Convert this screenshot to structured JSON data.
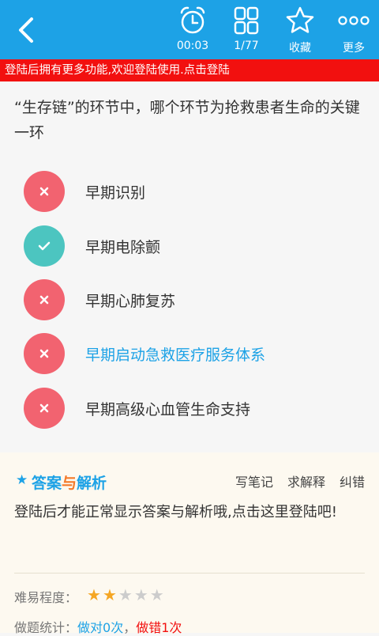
{
  "header": {
    "timer": "00:03",
    "progress": "1/77",
    "favorite_label": "收藏",
    "more_label": "更多"
  },
  "banner": {
    "text": "登陆后拥有更多功能,欢迎登陆使用.点击登陆"
  },
  "question": {
    "text": "“生存链”的环节中，哪个环节为抢救患者生命的关键一环"
  },
  "options": [
    {
      "label": "早期识别",
      "state": "wrong"
    },
    {
      "label": "早期电除颤",
      "state": "correct"
    },
    {
      "label": "早期心肺复苏",
      "state": "wrong"
    },
    {
      "label": "早期启动急救医疗服务体系",
      "state": "selected-wrong"
    },
    {
      "label": "早期高级心血管生命支持",
      "state": "wrong"
    }
  ],
  "answer_panel": {
    "title_part1": "答案",
    "title_part2": "与",
    "title_part3": "解析",
    "links": [
      "写笔记",
      "求解释",
      "纠错"
    ],
    "message": "登陆后才能正常显示答案与解析哦,点击这里登陆吧!",
    "difficulty_label": "难易程度：",
    "difficulty_stars": 2,
    "difficulty_max": 5,
    "stats_label": "做题统计：",
    "stats_correct": "做对0次",
    "stats_sep": "，",
    "stats_wrong": "做错1次"
  },
  "colors": {
    "primary": "#1da2e6",
    "banner": "#f2100f",
    "wrong": "#f26370",
    "correct": "#4cc5c0",
    "star_on": "#f5a623",
    "star_off": "#cccccc"
  }
}
